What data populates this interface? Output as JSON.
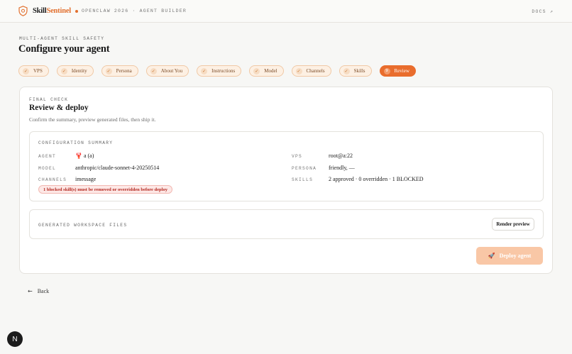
{
  "header": {
    "brand_part1": "Skill",
    "brand_part2": "Sentinel",
    "subtitle": "OPENCLAW 2026 · AGENT BUILDER",
    "docs_link": "DOCS ↗"
  },
  "page": {
    "eyebrow": "MULTI-AGENT SKILL SAFETY",
    "title": "Configure your agent"
  },
  "steps": [
    {
      "label": "VPS",
      "icon": "check-icon",
      "glyph": "✓"
    },
    {
      "label": "Identity",
      "icon": "check-icon",
      "glyph": "✓"
    },
    {
      "label": "Persona",
      "icon": "check-icon",
      "glyph": "✓"
    },
    {
      "label": "About You",
      "icon": "check-icon",
      "glyph": "✓"
    },
    {
      "label": "Instructions",
      "icon": "check-icon",
      "glyph": "✓"
    },
    {
      "label": "Model",
      "icon": "check-icon",
      "glyph": "✓"
    },
    {
      "label": "Channels",
      "icon": "check-icon",
      "glyph": "✓"
    },
    {
      "label": "Skills",
      "icon": "check-icon",
      "glyph": "✓"
    },
    {
      "label": "Review",
      "icon": "step-number-icon",
      "glyph": "9",
      "active": true
    }
  ],
  "review": {
    "eyebrow": "FINAL CHECK",
    "title": "Review & deploy",
    "description": "Confirm the summary, preview generated files, then ship it.",
    "summary": {
      "title": "CONFIGURATION SUMMARY",
      "agent_label": "AGENT",
      "agent_value": "🦞 a (a)",
      "model_label": "MODEL",
      "model_value": "anthropic/claude-sonnet-4-20250514",
      "channels_label": "CHANNELS",
      "channels_value": "imessage",
      "vps_label": "VPS",
      "vps_value": "root@a:22",
      "persona_label": "PERSONA",
      "persona_value": "friendly, —",
      "skills_label": "SKILLS",
      "skills_value": "2 approved · 0 overridden · 1 BLOCKED",
      "warning": "1 blocked skill(s) must be removed or overridden before deploy"
    },
    "files": {
      "title": "GENERATED WORKSPACE FILES",
      "render_label": "Render preview"
    },
    "deploy_label": "Deploy agent"
  },
  "footer": {
    "back_label": "Back",
    "badge_letter": "N"
  },
  "colors": {
    "accent": "#e96d2d",
    "accent_soft": "#fdf0e3",
    "danger": "#b3261e"
  }
}
